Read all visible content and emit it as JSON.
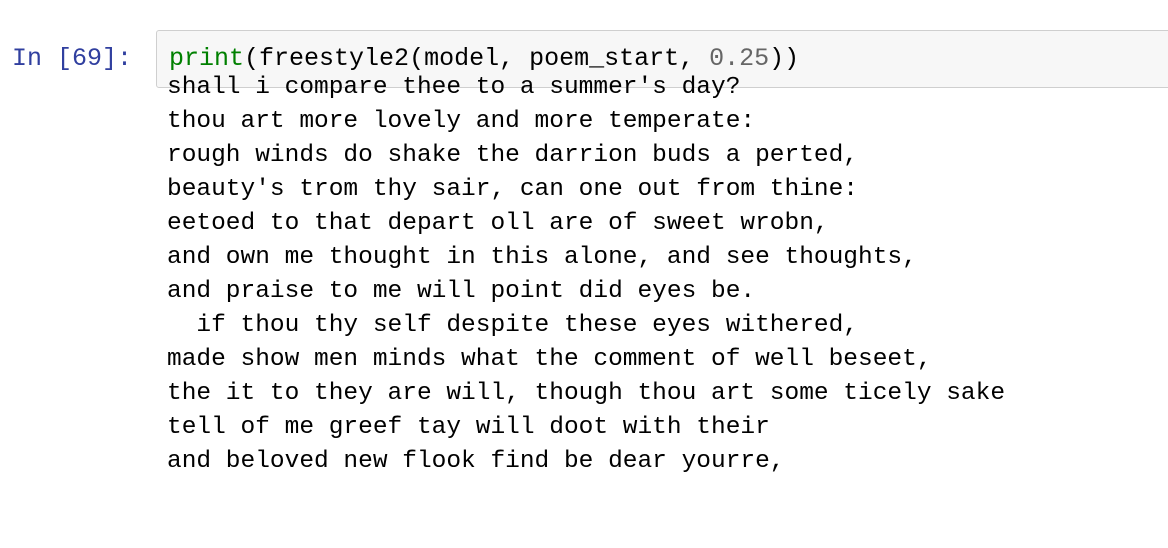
{
  "cell": {
    "prompt": "In [69]:",
    "code": {
      "func": "print",
      "open1": "(",
      "call": "freestyle2",
      "open2": "(",
      "args": "model, poem_start, ",
      "number": "0.25",
      "close": "))"
    }
  },
  "output": {
    "lines": [
      "shall i compare thee to a summer's day?",
      "thou art more lovely and more temperate:",
      "rough winds do shake the darrion buds a perted,",
      "beauty's trom thy sair, can one out from thine:",
      "eetoed to that depart oll are of sweet wrobn,",
      "and own me thought in this alone, and see thoughts,",
      "and praise to me will point did eyes be.",
      "  if thou thy self despite these eyes withered,",
      "made show men minds what the comment of well beseet,",
      "the it to they are will, though thou art some ticely sake",
      "tell of me greef tay will doot with their",
      "and beloved new flook find be dear yourre,"
    ]
  }
}
